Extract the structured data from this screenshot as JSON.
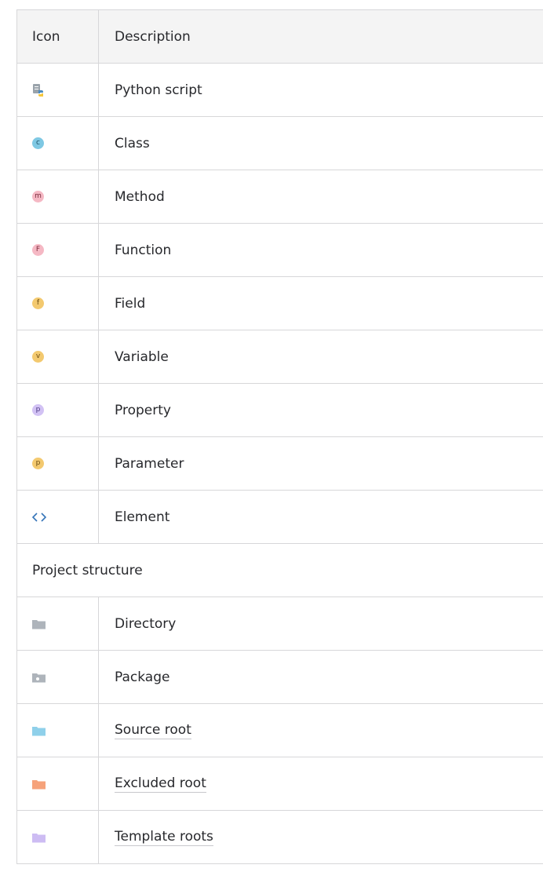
{
  "header": {
    "icon_col": "Icon",
    "desc_col": "Description"
  },
  "rows": [
    {
      "label": "Python script",
      "icon": "python-script-icon"
    },
    {
      "label": "Class",
      "icon": "class-icon",
      "letter": "c",
      "color": "#7ec8e3",
      "fg": "#1d4e63"
    },
    {
      "label": "Method",
      "icon": "method-icon",
      "letter": "m",
      "color": "#f5b8c4",
      "fg": "#7a2b3c"
    },
    {
      "label": "Function",
      "icon": "function-icon",
      "letter": "F",
      "color": "#f5b8c4",
      "fg": "#7a2b3c"
    },
    {
      "label": "Field",
      "icon": "field-icon",
      "letter": "f",
      "color": "#f3c96f",
      "fg": "#6b4b10"
    },
    {
      "label": "Variable",
      "icon": "variable-icon",
      "letter": "v",
      "color": "#f3c96f",
      "fg": "#6b4b10"
    },
    {
      "label": "Property",
      "icon": "property-icon",
      "letter": "p",
      "color": "#d2c2f4",
      "fg": "#4b3680"
    },
    {
      "label": "Parameter",
      "icon": "parameter-icon",
      "letter": "p",
      "color": "#f3c96f",
      "fg": "#6b4b10"
    },
    {
      "label": "Element",
      "icon": "element-icon"
    }
  ],
  "section": {
    "title": "Project structure"
  },
  "structure": [
    {
      "label": "Directory",
      "icon": "directory-folder-icon",
      "color": "#aeb4bb"
    },
    {
      "label": "Package",
      "icon": "package-folder-icon",
      "color": "#aeb4bb"
    },
    {
      "label": "Source root",
      "icon": "source-root-folder-icon",
      "color": "#8fd0ea",
      "link": true
    },
    {
      "label": "Excluded root",
      "icon": "excluded-root-folder-icon",
      "color": "#f6a27a",
      "link": true
    },
    {
      "label": "Template roots",
      "icon": "template-roots-folder-icon",
      "color": "#cdbcf3",
      "link": true
    }
  ]
}
